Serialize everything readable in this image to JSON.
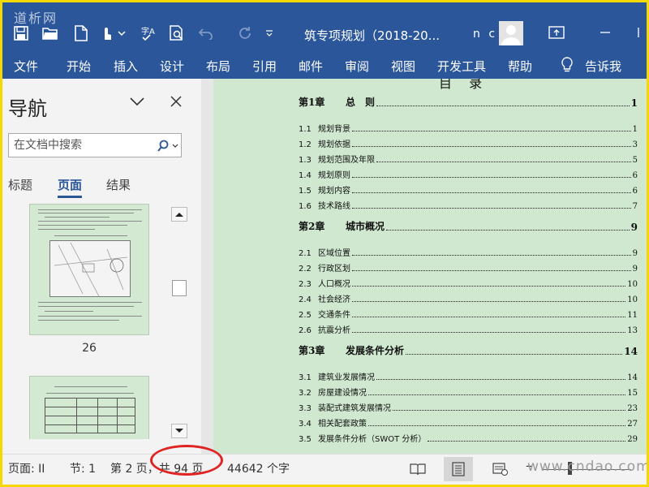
{
  "watermark_top": "道析网",
  "watermark_bottom": "www.cndao.com",
  "title_bar": {
    "doc_title": "筑专项规划（2018-20...",
    "user": "n c",
    "qat_icons": [
      "save-icon",
      "open-icon",
      "new-icon",
      "touch-mode-icon",
      "more-icon",
      "spelling-icon",
      "print-preview-icon",
      "undo-icon",
      "redo-icon",
      "customize-icon"
    ]
  },
  "ribbon": {
    "tabs": [
      "文件",
      "开始",
      "插入",
      "设计",
      "布局",
      "引用",
      "邮件",
      "审阅",
      "视图",
      "开发工具",
      "帮助"
    ],
    "tell_me": "告诉我"
  },
  "nav_pane": {
    "title": "导航",
    "search_placeholder": "在文档中搜索",
    "tabs": [
      "标题",
      "页面",
      "结果"
    ],
    "active_tab": "页面",
    "thumbnails": [
      {
        "page": "26"
      },
      {
        "page": ""
      }
    ]
  },
  "document": {
    "toc_heading": "目 录",
    "toc": [
      {
        "num": "第1章",
        "title": "总　则",
        "page": "1",
        "level": 1
      },
      {
        "num": "1.1",
        "title": "规划背景",
        "page": "1",
        "level": 2
      },
      {
        "num": "1.2",
        "title": "规划依据",
        "page": "3",
        "level": 2
      },
      {
        "num": "1.3",
        "title": "规划范围及年限",
        "page": "5",
        "level": 2
      },
      {
        "num": "1.4",
        "title": "规划原则",
        "page": "6",
        "level": 2
      },
      {
        "num": "1.5",
        "title": "规划内容",
        "page": "6",
        "level": 2
      },
      {
        "num": "1.6",
        "title": "技术路线",
        "page": "7",
        "level": 2
      },
      {
        "num": "第2章",
        "title": "城市概况",
        "page": "9",
        "level": 1
      },
      {
        "num": "2.1",
        "title": "区域位置",
        "page": "9",
        "level": 2
      },
      {
        "num": "2.2",
        "title": "行政区划",
        "page": "9",
        "level": 2
      },
      {
        "num": "2.3",
        "title": "人口概况",
        "page": "10",
        "level": 2
      },
      {
        "num": "2.4",
        "title": "社会经济",
        "page": "10",
        "level": 2
      },
      {
        "num": "2.5",
        "title": "交通条件",
        "page": "11",
        "level": 2
      },
      {
        "num": "2.6",
        "title": "抗震分析",
        "page": "13",
        "level": 2
      },
      {
        "num": "第3章",
        "title": "发展条件分析",
        "page": "14",
        "level": 1
      },
      {
        "num": "3.1",
        "title": "建筑业发展情况",
        "page": "14",
        "level": 2
      },
      {
        "num": "3.2",
        "title": "房屋建设情况",
        "page": "15",
        "level": 2
      },
      {
        "num": "3.3",
        "title": "装配式建筑发展情况",
        "page": "23",
        "level": 2
      },
      {
        "num": "3.4",
        "title": "相关配套政策",
        "page": "27",
        "level": 2
      },
      {
        "num": "3.5",
        "title": "发展条件分析（SWOT 分析）",
        "page": "29",
        "level": 2
      }
    ]
  },
  "status_bar": {
    "page_label": "页面: II",
    "section": "节: 1",
    "page_count": "第 2 页，共 94 页",
    "word_count": "44642 个字"
  }
}
